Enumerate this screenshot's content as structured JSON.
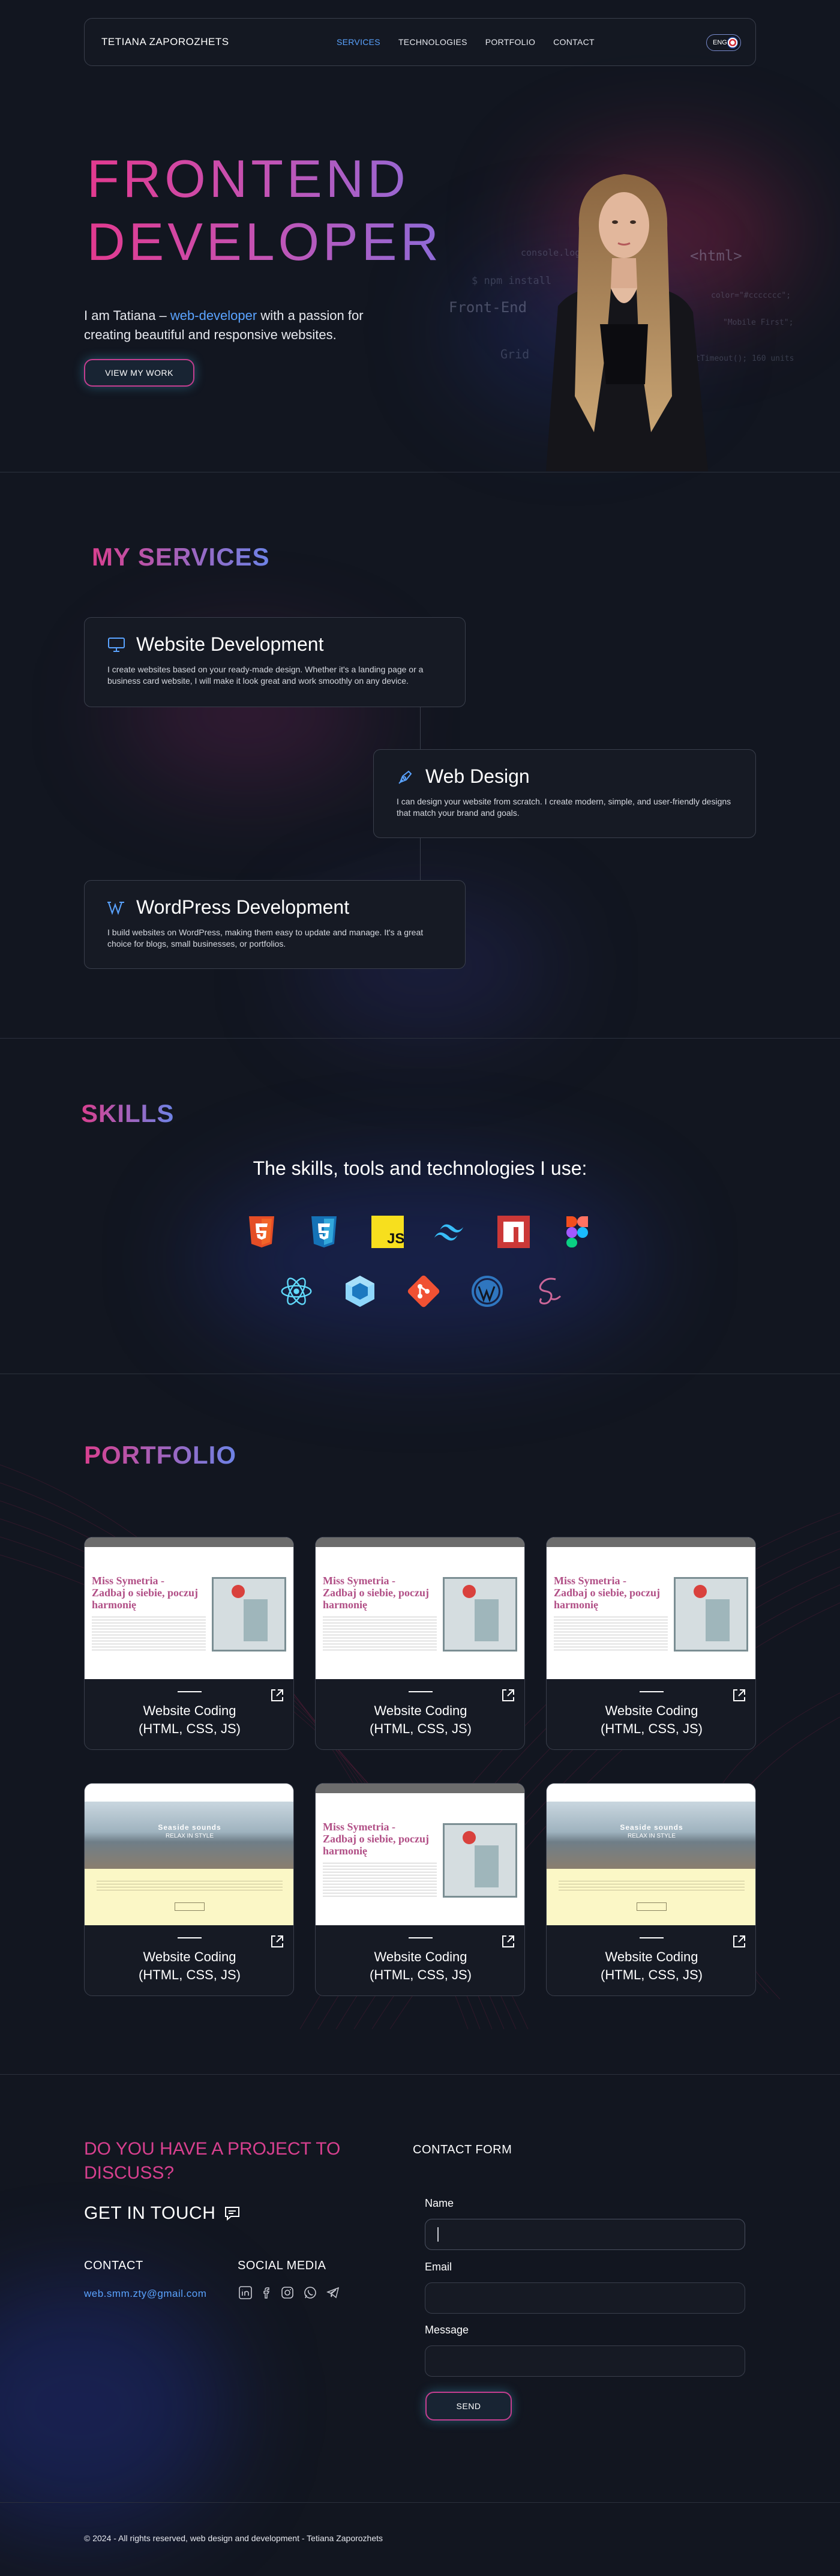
{
  "header": {
    "brand": "TETIANA ZAPOROZHETS",
    "nav": [
      "SERVICES",
      "TECHNOLOGIES",
      "PORTFOLIO",
      "CONTACT"
    ],
    "active_nav": "SERVICES",
    "lang": "ENG"
  },
  "hero": {
    "title_line1": "FRONTEND",
    "title_line2": "DEVELOPER",
    "intro_prefix": "I am Tatiana – ",
    "intro_highlight": "web-developer",
    "intro_suffix": " with a passion for creating beautiful and responsive websites.",
    "cta": "VIEW MY WORK",
    "code_bg": {
      "line1": "console.log();",
      "line2": "<html>",
      "line3": "$ npm install",
      "line4": "Front-End",
      "line5": "color=\"#ccccccc\";",
      "line6": "\"Mobile First\";",
      "line7": "Grid",
      "line8": "&& setTimeout(); 160 units"
    }
  },
  "services": {
    "title": "MY SERVICES",
    "items": [
      {
        "title": "Website Development",
        "text": "I create websites based on your ready-made design. Whether it's a landing page or a business card website, I will make it look great and work smoothly on any device.",
        "icon": "monitor-icon"
      },
      {
        "title": "Web Design",
        "text": "I can design your website from scratch. I create modern, simple, and user-friendly designs that match your brand and goals.",
        "icon": "pen-tool-icon"
      },
      {
        "title": "WordPress Development",
        "text": "I build websites on WordPress, making them easy to update and manage. It's a great choice for blogs, small businesses, or portfolios.",
        "icon": "wordpress-icon"
      }
    ]
  },
  "skills": {
    "title": "SKILLS",
    "subtitle": "The skills, tools and technologies I use:",
    "icons": [
      "html5-icon",
      "css3-icon",
      "javascript-icon",
      "tailwind-icon",
      "npm-icon",
      "figma-icon",
      "react-icon",
      "webpack-icon",
      "git-icon",
      "wordpress-icon",
      "sass-icon"
    ],
    "js_label": "JS"
  },
  "portfolio": {
    "title": "PORTFOLIO",
    "card_label_1": "Website Coding",
    "card_label_2": "(HTML, CSS, JS)",
    "shot_a": {
      "heading1": "Miss Symetria -",
      "heading2": "Zadbaj o siebie, poczuj",
      "heading3": "harmonię"
    },
    "shot_b": {
      "heading": "Seaside sounds",
      "sub": "RELAX IN STYLE"
    }
  },
  "contact": {
    "question": "DO YOU HAVE A PROJECT TO DISCUSS?",
    "get_in_touch": "GET IN TOUCH",
    "contact_heading": "CONTACT",
    "email": "web.smm.zty@gmail.com",
    "social_heading": "SOCIAL MEDIA",
    "social_icons": [
      "linkedin-icon",
      "facebook-icon",
      "instagram-icon",
      "whatsapp-icon",
      "telegram-icon"
    ],
    "form_heading": "CONTACT FORM",
    "name_label": "Name",
    "email_label": "Email",
    "message_label": "Message",
    "send": "SEND"
  },
  "footer": {
    "text": "© 2024 - All rights reserved, web design and development - Tetiana Zaporozhets"
  },
  "colors": {
    "background": "#121620",
    "accent_pink": "#d8408f",
    "accent_blue": "#5aa3ff",
    "border": "#3a3f4c"
  }
}
